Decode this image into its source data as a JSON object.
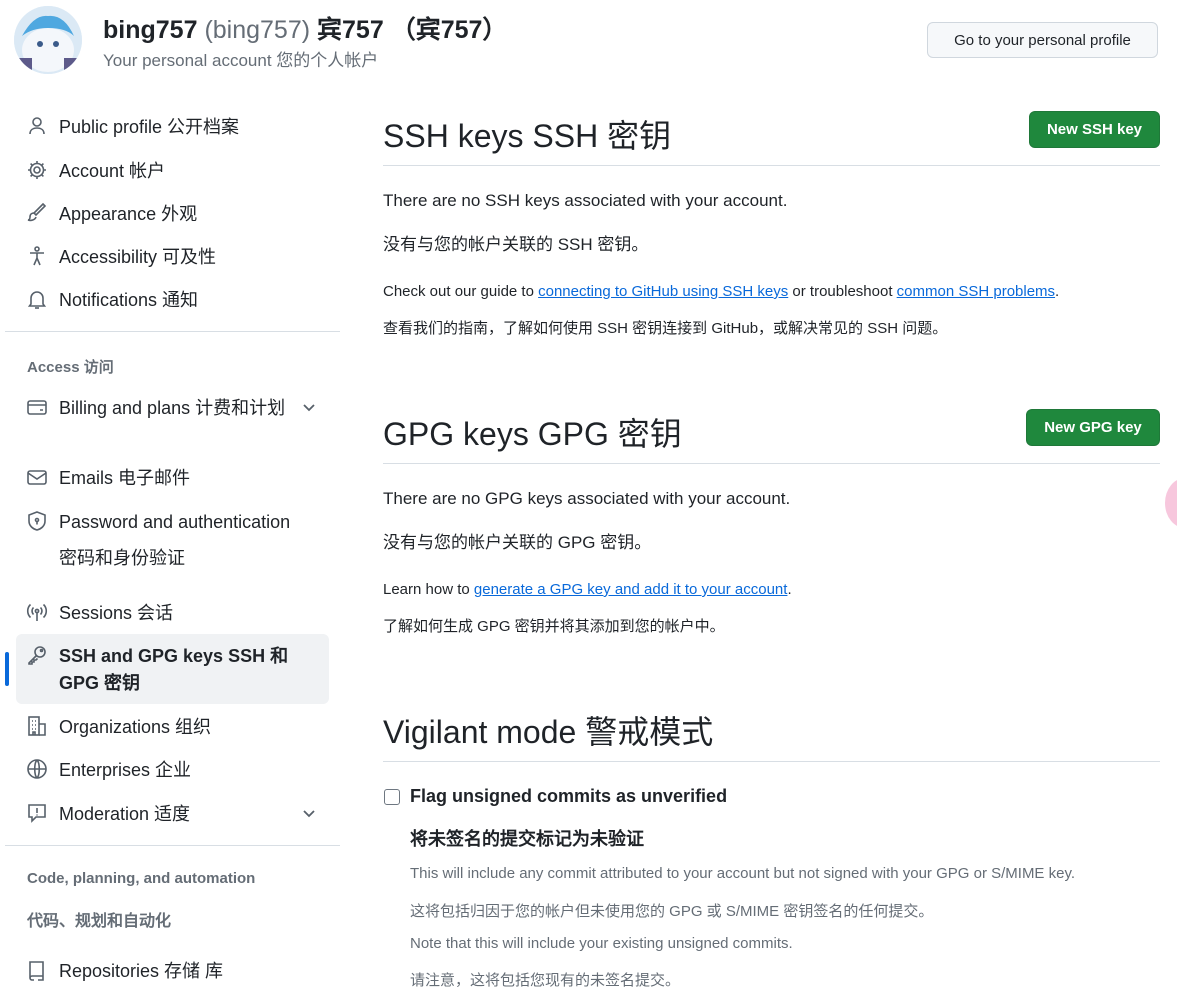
{
  "header": {
    "username": "bing757",
    "login_paren": "(bing757)",
    "display_name": "宾757 （宾757）",
    "subtitle": "Your personal account  您的个人帐户",
    "profile_button": "Go to your personal profile"
  },
  "sidebar": {
    "items": [
      {
        "label": "Public profile  公开档案",
        "icon": "person-icon"
      },
      {
        "label": "Account  帐户",
        "icon": "gear-icon"
      },
      {
        "label": "Appearance  外观",
        "icon": "paintbrush-icon"
      },
      {
        "label": "Accessibility  可及性",
        "icon": "accessibility-icon"
      },
      {
        "label": "Notifications  通知",
        "icon": "bell-icon"
      }
    ],
    "access_heading": "Access  访问",
    "access_items": [
      {
        "label": "Billing and plans  计费和计划",
        "icon": "credit-card-icon",
        "expandable": true
      },
      {
        "label": "Emails  电子邮件",
        "icon": "mail-icon"
      },
      {
        "label": "Password and authentication 密码和身份验证",
        "icon": "shield-lock-icon"
      },
      {
        "label": "Sessions  会话",
        "icon": "broadcast-icon"
      },
      {
        "label": "SSH and GPG keys  SSH 和 GPG 密钥",
        "icon": "key-icon",
        "active": true
      },
      {
        "label": "Organizations  组织",
        "icon": "organization-icon"
      },
      {
        "label": "Enterprises  企业",
        "icon": "globe-icon"
      },
      {
        "label": "Moderation  适度",
        "icon": "report-icon",
        "expandable": true
      }
    ],
    "code_heading": "Code, planning, and automation",
    "code_heading_cn": "代码、规划和自动化",
    "code_items": [
      {
        "label": "Repositories  存储 库",
        "icon": "repo-icon"
      }
    ]
  },
  "ssh": {
    "title": "SSH keys SSH 密钥",
    "button": "New SSH key",
    "empty_en": "There are no SSH keys associated with your account.",
    "empty_cn": "没有与您的帐户关联的 SSH 密钥。",
    "guide_pre": "Check out our guide to ",
    "guide_link1": "connecting to GitHub using SSH keys",
    "guide_mid": " or troubleshoot ",
    "guide_link2": "common SSH problems",
    "guide_end": ".",
    "guide_cn": "查看我们的指南，了解如何使用 SSH 密钥连接到 GitHub，或解决常见的 SSH 问题。"
  },
  "gpg": {
    "title": "GPG keys GPG 密钥",
    "button": "New GPG key",
    "empty_en": "There are no GPG keys associated with your account.",
    "empty_cn": "没有与您的帐户关联的 GPG 密钥。",
    "learn_pre": "Learn how to ",
    "learn_link": "generate a GPG key and add it to your account",
    "learn_end": ".",
    "learn_cn": "了解如何生成 GPG 密钥并将其添加到您的帐户中。"
  },
  "vigilant": {
    "title": "Vigilant mode  警戒模式",
    "checkbox_label": "Flag unsigned commits as unverified",
    "checkbox_label_cn": "将未签名的提交标记为未验证",
    "checked": false,
    "desc1": "This will include any commit attributed to your account but not signed with your GPG or S/MIME key.",
    "desc1_cn": "这将包括归因于您的帐户但未使用您的 GPG 或 S/MIME 密钥签名的任何提交。",
    "desc2": "Note that this will include your existing unsigned commits.",
    "desc2_cn": "请注意，这将包括您现有的未签名提交。"
  },
  "colors": {
    "accent": "#0969da",
    "primary_button": "#1f883d",
    "text": "#1f2328",
    "muted": "#656d76"
  }
}
